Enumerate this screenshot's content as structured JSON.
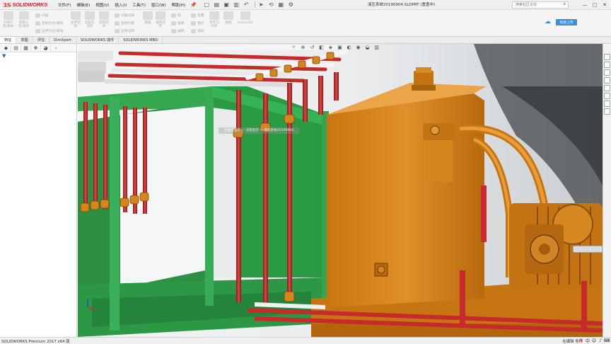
{
  "app": {
    "logo_ds": "3S",
    "logo_text": "SOLIDWORKS",
    "doc_title": "液压系统20190904.SLDPRT (重置中)"
  },
  "menu": [
    "文件(F)",
    "编辑(E)",
    "视图(V)",
    "插入(I)",
    "工具(T)",
    "窗口(W)",
    "帮助(H)"
  ],
  "search": {
    "placeholder": "搜索社区论坛"
  },
  "ribbon": {
    "groups": [
      {
        "label": "拉伸凸\n台/基体"
      },
      {
        "label": "旋转凸\n台/基体"
      },
      {
        "label": "拉伸切\n除"
      },
      {
        "label": "异型孔\n向导"
      },
      {
        "label": "旋转切\n除"
      },
      {
        "label": "圆角"
      },
      {
        "label": "线性阵\n列"
      },
      {
        "label": "筋"
      },
      {
        "label": "参考几\n何体"
      },
      {
        "label": "曲线"
      },
      {
        "label": "Instant3D"
      }
    ],
    "rows": [
      "扫描",
      "放样凸台/基体",
      "边界凸台/基体",
      "扫描切除",
      "放样切割",
      "边界切除",
      "拔模",
      "抽壳",
      "相交",
      "包覆",
      "镜向"
    ],
    "upload_label": "指南上传"
  },
  "tabs": [
    "特征",
    "草图",
    "评估",
    "DimXpert",
    "SOLIDWORKS 插件",
    "SOLIDWORKS MBD"
  ],
  "active_tab": 0,
  "watermark": "主图层显示 — 渲染显示 — 液压系统20190904",
  "status": {
    "left": "SOLIDWORKS Premium 2017 x64 版",
    "right": "在编辑 零件"
  },
  "colors": {
    "orange": "#d98318",
    "orange_dark": "#a85f0c",
    "red_pipe": "#c62a2a",
    "green_frame": "#2fa24a",
    "gray_pipe": "#e4e4e4",
    "accent": "#3b8fd8"
  }
}
